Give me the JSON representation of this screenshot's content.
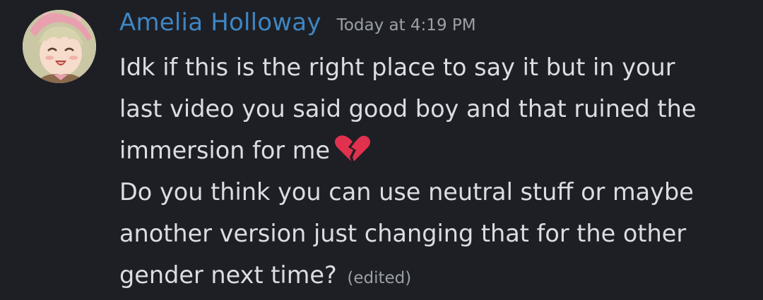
{
  "message": {
    "author": "Amelia Holloway",
    "timestamp": "Today at 4:19 PM",
    "lines": [
      "Idk if this is the right place to say it but in your",
      "last video you said good boy and that ruined the",
      "immersion for me",
      "Do you think you can use neutral stuff or maybe",
      "another version just changing that for the other",
      "gender next time?"
    ],
    "emoji": "broken-heart-icon",
    "edited_label": "(edited)"
  },
  "colors": {
    "background": "#1e1f24",
    "author": "#3e86c4",
    "text": "#dadde2",
    "muted": "#9aa0a8",
    "emoji": "#e0314f"
  }
}
